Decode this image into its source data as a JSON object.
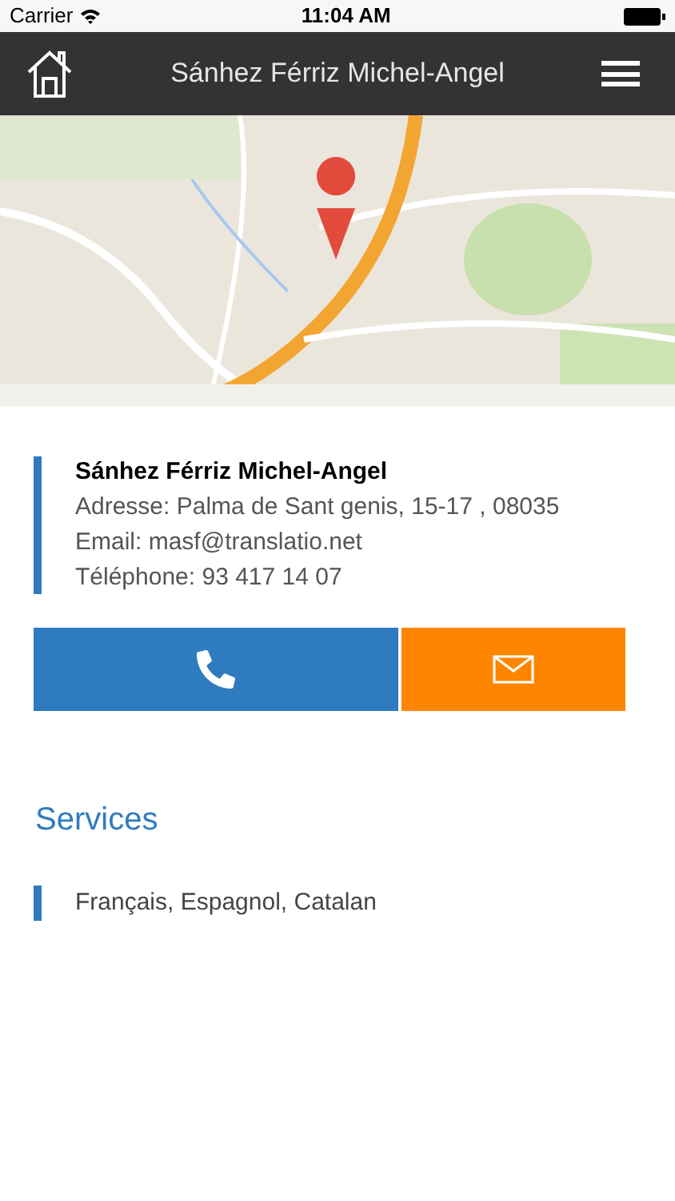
{
  "status_bar": {
    "carrier": "Carrier",
    "time": "11:04 AM"
  },
  "header": {
    "title": "Sánhez Férriz Michel-Angel"
  },
  "contact": {
    "name": "Sánhez Férriz Michel-Angel",
    "lines": [
      "Adresse: Palma de Sant genis, 15-17 , 08035",
      "Email: masf@translatio.net",
      "Téléphone: 93 417 14 07"
    ]
  },
  "actions": [
    {
      "kind": "call"
    },
    {
      "kind": "email"
    }
  ],
  "services": {
    "heading": "Services",
    "items": [
      "Français, Espagnol, Catalan"
    ]
  }
}
